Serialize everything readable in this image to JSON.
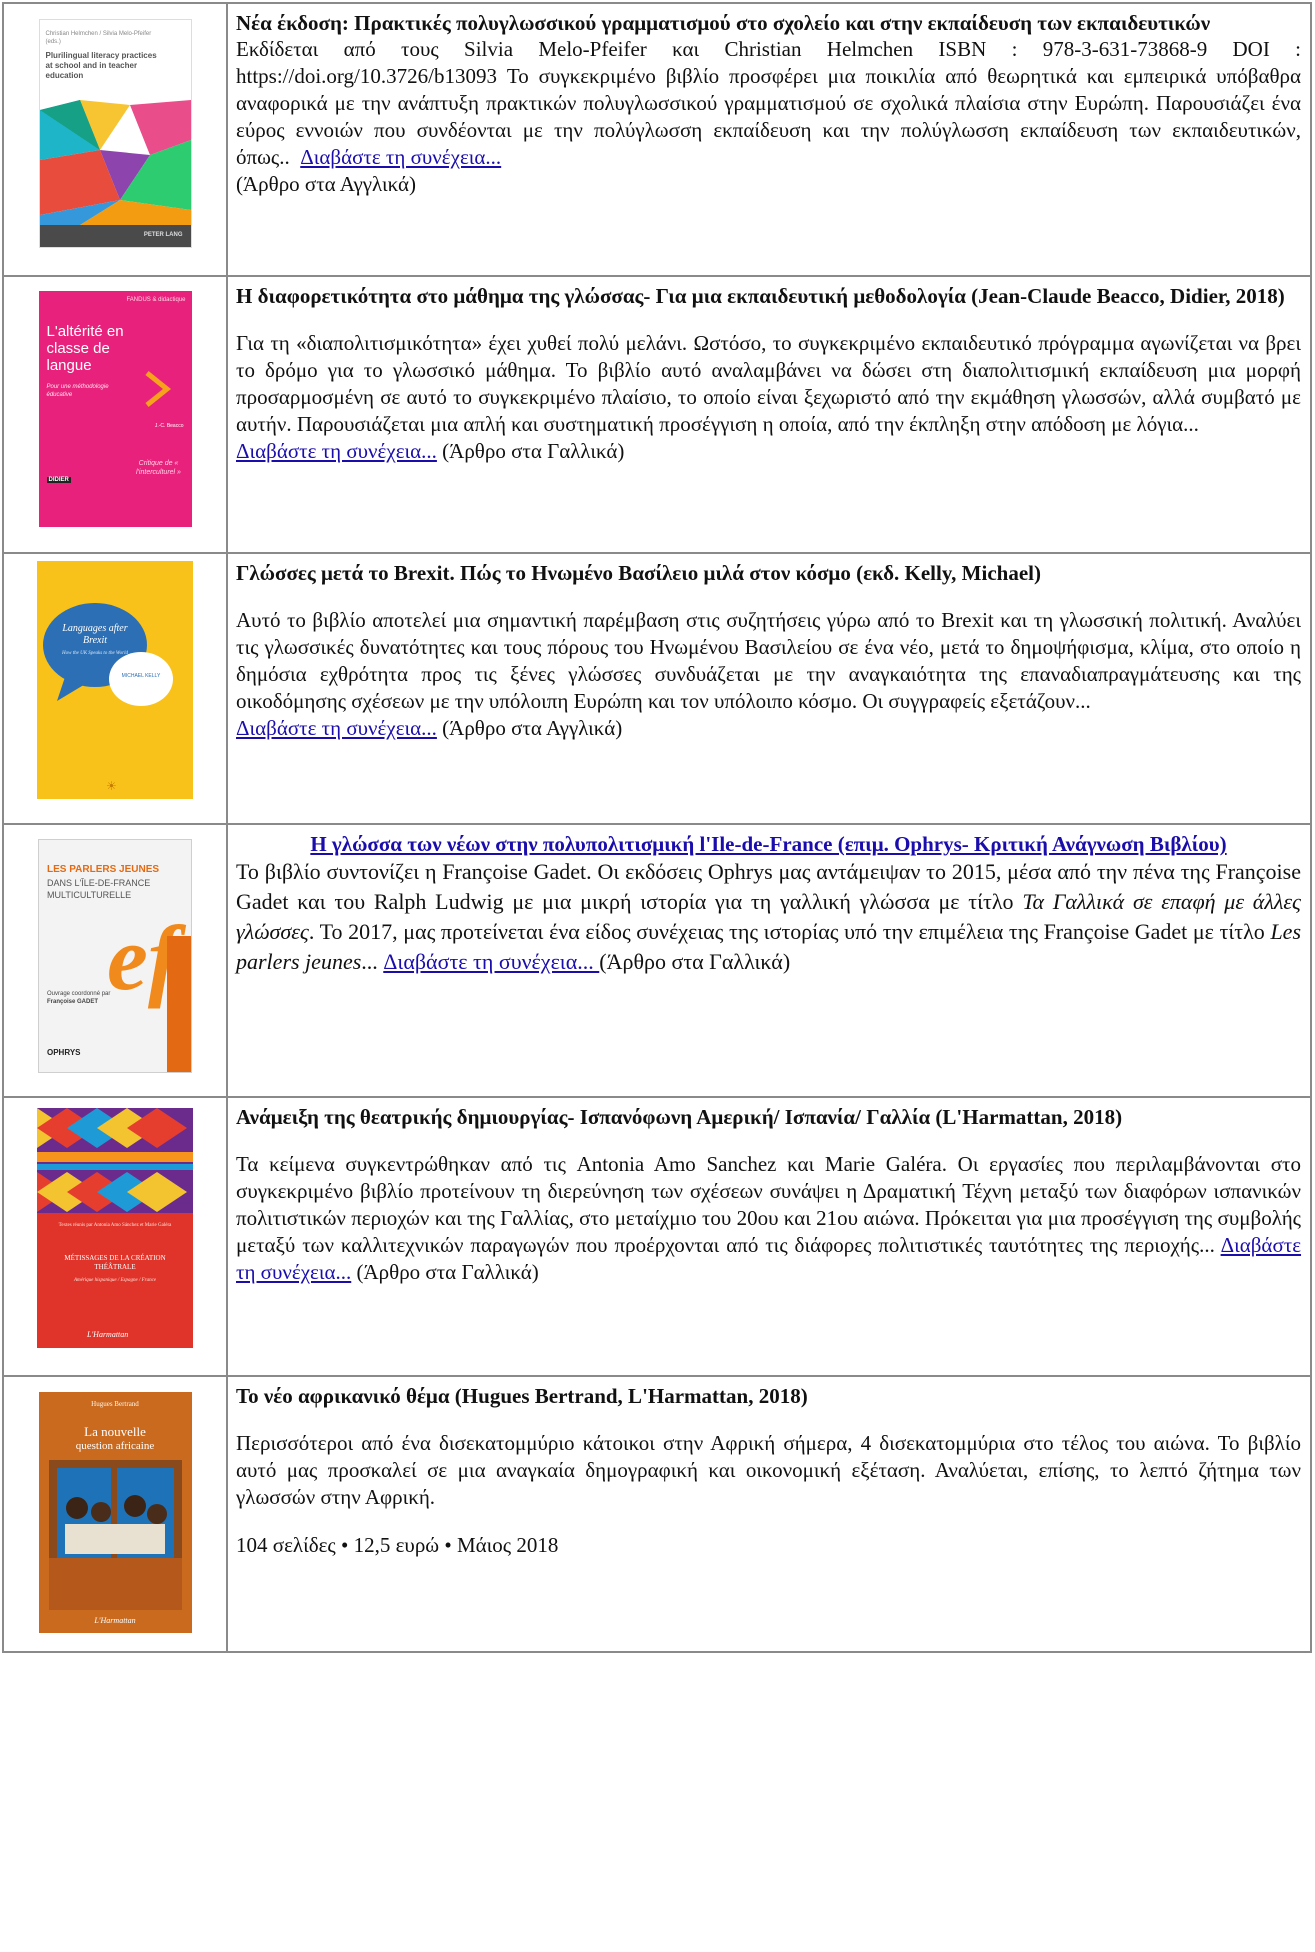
{
  "rows": [
    {
      "title": "Νέα έκδοση: Πρακτικές πολυγλωσσικού γραμματισμού στο σχολείο και στην εκπαίδευση των εκπαιδευτικών",
      "body": "Εκδίδεται από τους Silvia Melo-Pfeifer και Christian Helmchen ISBN : 978-3-631-73868-9 DOI : https://doi.org/10.3726/b13093 Το συγκεκριμένο βιβλίο προσφέρει μια ποικιλία από θεωρητικά και εμπειρικά υπόβαθρα αναφορικά με την ανάπτυξη πρακτικών πολυγλωσσικού γραμματισμού σε σχολικά πλαίσια στην Ευρώπη. Παρουσιάζει ένα εύρος εννοιών που συνδέονται με την πολύγλωσση εκπαίδευση και την πολύγλωσση εκπαίδευση των εκπαιδευτικών, όπως..",
      "link": "Διαβάστε τη συνέχεια...",
      "note": "(Άρθρο στα Αγγλικά)",
      "cover": {
        "editors": "Christian Helmchen / Silvia Melo-Pfeifer (eds.)",
        "title": "Plurilingual literacy practices at school and in teacher education",
        "publisher": "PETER LANG"
      }
    },
    {
      "title": "Η διαφορετικότητα στο μάθημα της γλώσσας- Για μια εκπαιδευτική μεθοδολογία (Jean-Claude Beacco, Didier, 2018)",
      "body": "Για τη «διαπολιτισμικότητα» έχει χυθεί πολύ μελάνι. Ωστόσο, το συγκεκριμένο εκπαιδευτικό πρόγραμμα αγωνίζεται να βρει το δρόμο για το γλωσσικό μάθημα. Το βιβλίο αυτό αναλαμβάνει να δώσει στη διαπολιτισμική εκπαίδευση μια μορφή προσαρμοσμένη σε αυτό το συγκεκριμένο πλαίσιο, το οποίο είναι ξεχωριστό από την εκμάθηση γλωσσών, αλλά συμβατό με αυτήν. Παρουσιάζεται μια απλή και συστηματική προσέγγιση η οποία, από την έκπληξη στην απόδοση με λόγια...",
      "link": "Διαβάστε τη συνέχεια...",
      "note": " (Άρθρο στα Γαλλικά)",
      "cover": {
        "series": "FANDUS & didactique",
        "title": "L'altérité en classe de langue",
        "subtitle": "Pour une méthodologie éducative",
        "author": "J.-C. Beacco",
        "critique": "Critique de « l'interculturel »",
        "publisher": "DIDIER"
      }
    },
    {
      "title": "Γλώσσες μετά το Brexit. Πώς το Ηνωμένο Βασίλειο μιλά στον κόσμο (εκδ. Kelly, Michael)",
      "body": "Αυτό το βιβλίο αποτελεί μια σημαντική παρέμβαση στις συζητήσεις γύρω από το Brexit και τη γλωσσική πολιτική. Αναλύει τις γλωσσικές δυνατότητες και τους πόρους του Ηνωμένου Βασιλείου σε ένα νέο, μετά το δημοψήφισμα, κλίμα, στο οποίο η δημόσια εχθρότητα προς τις ξένες γλώσσες συνδυάζεται με την αναγκαιότητα της επαναδιαπραγμάτευσης και της οικοδόμησης σχέσεων με την υπόλοιπη Ευρώπη και τον υπόλοιπο κόσμο. Οι συγγραφείς εξετάζουν...",
      "link": "Διαβάστε τη συνέχεια...",
      "note": " (Άρθρο στα Αγγλικά)",
      "cover": {
        "title": "Languages after Brexit",
        "subtitle": "How the UK Speaks to the World",
        "author": "MICHAEL KELLY"
      }
    },
    {
      "title_link": "Η γλώσσα των νέων στην πολυπολιτισμική l'Ile-de-France (επιμ. Ophrys- Κριτική Ανάγνωση Βιβλίου)",
      "body_1": "Το βιβλίο συντονίζει η Françoise Gadet. Οι εκδόσεις Ophrys μας αντάμειψαν το 2015, μέσα από την πένα της Françoise Gadet και του Ralph Ludwig με μια μικρή ιστορία για τη γαλλική γλώσσα με τίτλο ",
      "italic_1": "Τα Γαλλικά σε επαφή με άλλες γλώσσες",
      "body_2": ". Το 2017, μας προτείνεται ένα είδος συνέχειας της ιστορίας υπό την επιμέλεια της Françoise Gadet με τίτλο ",
      "italic_2": "Les parlers jeunes",
      "body_3": "... ",
      "link": "Διαβάστε τη συνέχεια... ",
      "note": "(Άρθρο στα Γαλλικά)",
      "cover": {
        "title_1": "LES PARLERS JEUNES",
        "title_2": "DANS L'ÎLE-DE-FRANCE",
        "title_3": "MULTICULTURELLE",
        "coord_1": "Ouvrage coordonné par",
        "coord_2": "Françoise GADET",
        "logo": "ef",
        "spine": "l'essentiel français",
        "publisher": "OPHRYS"
      }
    },
    {
      "title": "Ανάμειξη της θεατρικής δημιουργίας- Ισπανόφωνη Αμερική/ Ισπανία/ Γαλλία (L'Harmattan, 2018)",
      "body": "Τα κείμενα συγκεντρώθηκαν από τις Antonia Amo Sanchez και Marie Galéra. Οι εργασίες που περιλαμβάνονται στο συγκεκριμένο βιβλίο προτείνουν τη διερεύνηση των σχέσεων συνάψει η Δραματική Τέχνη μεταξύ των διαφόρων ισπανικών πολιτιστικών περιοχών και της Γαλλίας, στο μεταίχμιο του 20ου και 21ου αιώνα. Πρόκειται για μια προσέγγιση της συμβολής μεταξύ των καλλιτεχνικών παραγωγών που προέρχονται από τις διάφορες πολιτιστικές ταυτότητες της περιοχής...",
      "link": "Διαβάστε τη συνέχεια...",
      "note": " (Άρθρο στα Γαλλικά)",
      "cover": {
        "editors": "Textes réunis par Antonia Amo Sánchez et Marie Galéra",
        "title": "MÉTISSAGES DE LA CRÉATION THÉÂTRALE",
        "subtitle": "Amérique hispanique / Espagne / France",
        "publisher": "L'Harmattan"
      }
    },
    {
      "title": "Το νέο αφρικανικό θέμα (Hugues Bertrand, L'Harmattan, 2018)",
      "body": "Περισσότεροι από ένα δισεκατομμύριο κάτοικοι στην Αφρική σήμερα, 4 δισεκατομμύρια στο τέλος του αιώνα. Το βιβλίο αυτό μας προσκαλεί σε μια αναγκαία δημογραφική και οικονομική εξέταση. Αναλύεται, επίσης, το λεπτό ζήτημα των γλωσσών στην Αφρική.",
      "meta": "104 σελίδες • 12,5 ευρώ • Μάιος 2018",
      "cover": {
        "author": "Hugues Bertrand",
        "title_1": "La nouvelle",
        "title_2": "question africaine",
        "publisher": "L'Harmattan"
      }
    }
  ]
}
